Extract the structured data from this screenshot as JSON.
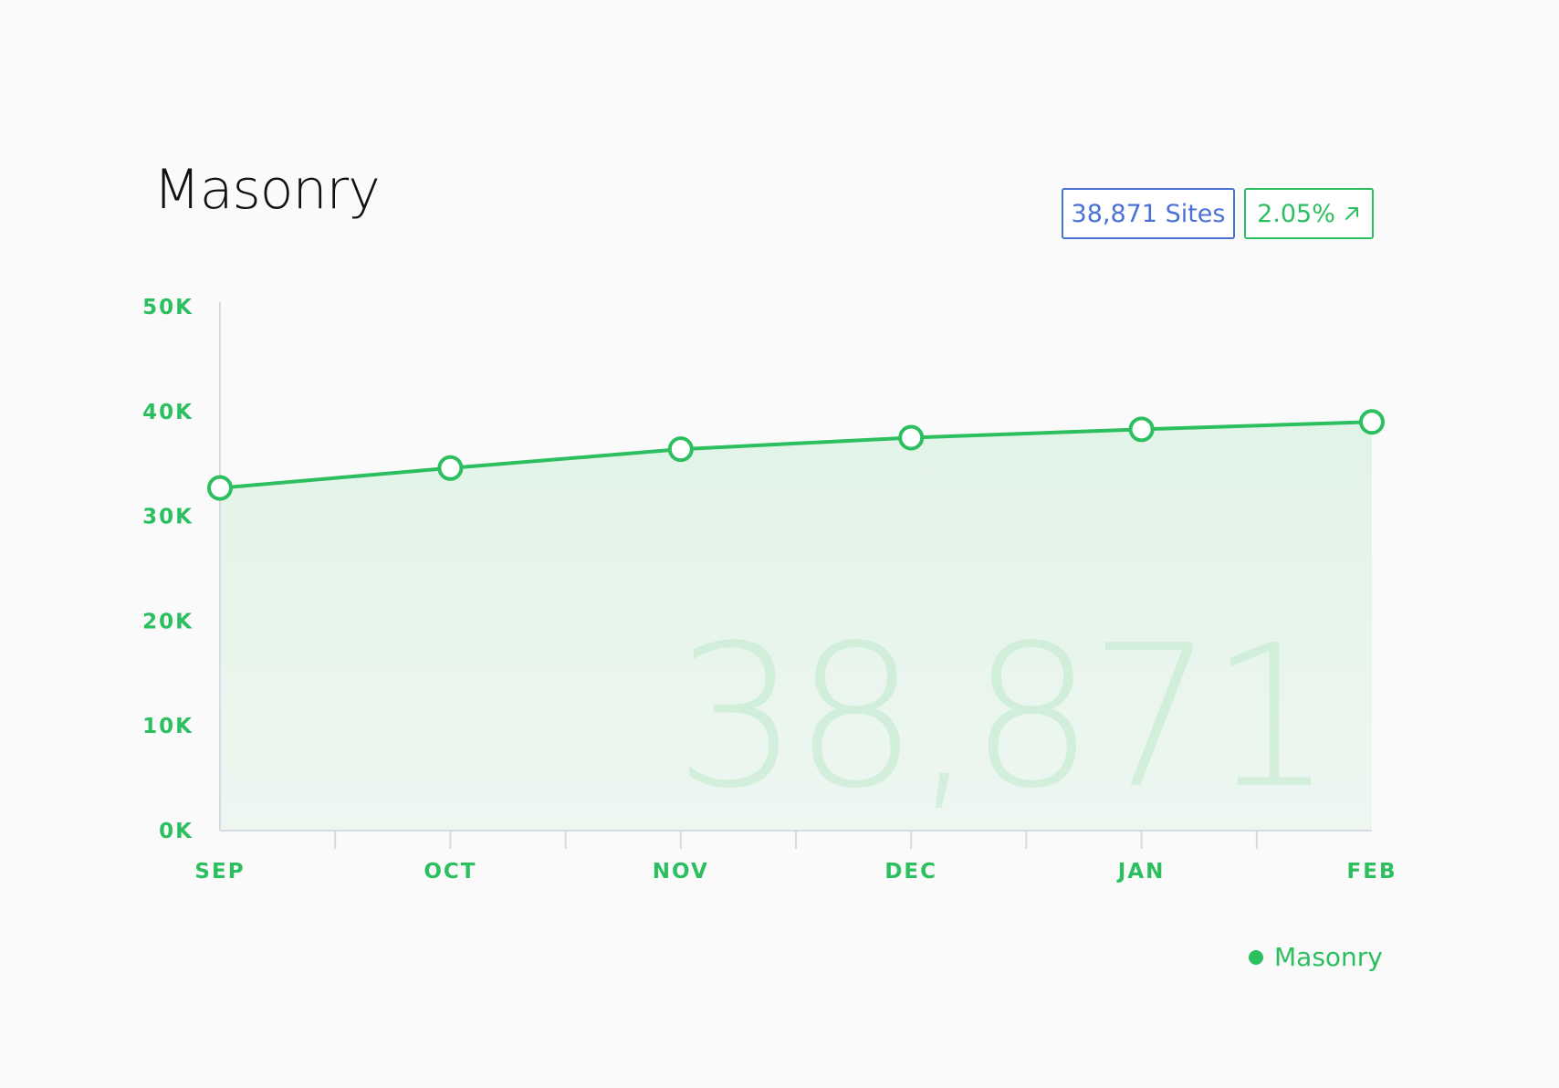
{
  "header": {
    "title": "Masonry",
    "sites_badge": "38,871 Sites",
    "change_badge": "2.05%",
    "change_icon": "arrow-up-right-icon"
  },
  "colors": {
    "accent": "#2cbf5f",
    "badge_blue": "#4a72d6",
    "background": "#fafafa"
  },
  "chart_data": {
    "type": "area",
    "title": "Masonry",
    "categories": [
      "SEP",
      "OCT",
      "NOV",
      "DEC",
      "JAN",
      "FEB"
    ],
    "series": [
      {
        "name": "Masonry",
        "values": [
          32700,
          34600,
          36400,
          37500,
          38300,
          39000
        ]
      }
    ],
    "yticks": [
      "0K",
      "10K",
      "20K",
      "30K",
      "40K",
      "50K"
    ],
    "ylim": [
      0,
      50000
    ],
    "xlabel": "",
    "ylabel": "",
    "watermark": "38,871",
    "legend": {
      "position": "bottom-right",
      "entries": [
        "Masonry"
      ]
    },
    "grid": false
  }
}
